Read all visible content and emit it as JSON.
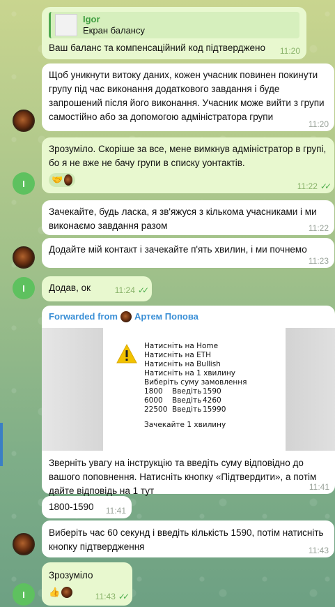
{
  "messages": {
    "m1": {
      "reply_name": "Igor",
      "reply_text": "Екран балансу",
      "text": "Ваш баланс та компенсаційний код підтверджено",
      "time": "11:20"
    },
    "m2": {
      "text": "Щоб уникнути витоку даних, кожен учасник повинен покинути групу під час виконання додаткового завдання і буде запрошений після його виконання. Учасник може вийти з групи самостійно або за допомогою адміністратора групи",
      "time": "11:20"
    },
    "m3": {
      "text": "Зрозуміло. Скоріше за все, мене вимкнув адміністратор в групі, бо я не вже не бачу групи в списку уонтактів.",
      "time": "11:22",
      "reaction": "🤝"
    },
    "m4": {
      "text": "Зачекайте, будь ласка, я зв'яжуся з кількома учасниками і ми виконаємо завдання разом",
      "time": "11:22"
    },
    "m5": {
      "text": "Додайте мій контакт і зачекайте п'ять хвилин, і ми почнемо",
      "time": "11:23"
    },
    "m6": {
      "text": "Додав, ок",
      "time": "11:24"
    },
    "m7": {
      "forwarded_label": "Forwarded from",
      "forwarded_name": "Артем Попова",
      "text": "Зверніть увагу на інструкцію та введіть суму відповідно до вашого поповнення. Натисніть кнопку «Підтвердити», а потім дайте відповідь на 1 тут",
      "time": "11:41",
      "image": {
        "lines": [
          "Натисніть на Home",
          "Натисніть на ETH",
          "Натисніть на Bullish",
          "Натисніть на 1 хвилину",
          "Виберіть суму замовлення"
        ],
        "rows": [
          {
            "amount": "1800",
            "label": "Введіть",
            "value": "1590"
          },
          {
            "amount": "6000",
            "label": "Введіть",
            "value": "4260"
          },
          {
            "amount": "22500",
            "label": "Введіть",
            "value": "15990"
          }
        ],
        "footer": "Зачекайте 1 хвилину"
      }
    },
    "m8": {
      "text": "1800-1590",
      "time": "11:41"
    },
    "m9": {
      "text": "Виберіть час 60 секунд і введіть кількість 1590, потім натисніть кнопку підтвердження",
      "time": "11:43"
    },
    "m10": {
      "text": "Зрозуміло",
      "time": "11:43",
      "reaction": "👍"
    }
  },
  "avatars": {
    "own_initial": "I"
  },
  "colors": {
    "outgoing": "#e8f8cf",
    "incoming": "#ffffff",
    "accent_green": "#4fae4e",
    "link_blue": "#3a8fd6"
  }
}
